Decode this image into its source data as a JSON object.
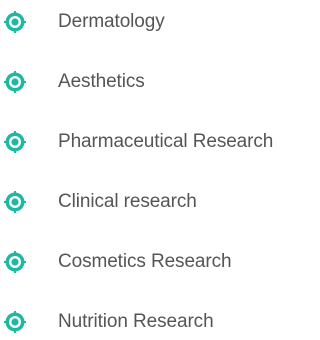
{
  "services": {
    "icon": "target-bullet-icon",
    "accent_color": "#1fb8a5",
    "items": [
      {
        "label": "Dermatology"
      },
      {
        "label": "Aesthetics"
      },
      {
        "label": "Pharmaceutical Research"
      },
      {
        "label": "Clinical research"
      },
      {
        "label": "Cosmetics Research"
      },
      {
        "label": "Nutrition Research"
      }
    ]
  }
}
